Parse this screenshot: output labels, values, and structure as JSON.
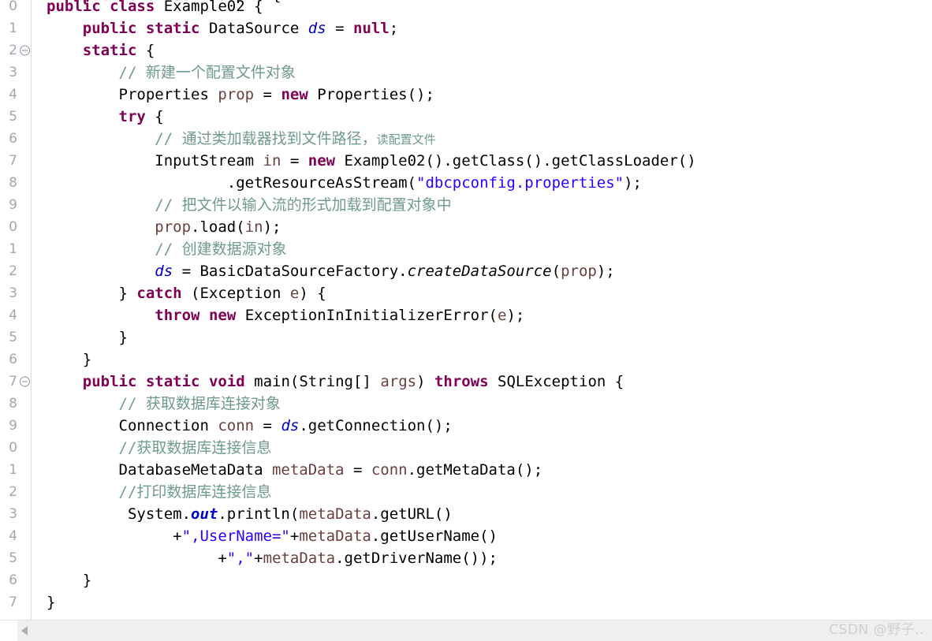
{
  "editor": {
    "language": "java",
    "class_name": "Example02",
    "colors": {
      "keyword": "#7f0055",
      "comment": "#6f9b8a",
      "string": "#2a00ff",
      "field": "#0000c0",
      "local_variable": "#6a3e3e",
      "plain": "#000000",
      "gutter_text": "#a0a8b4",
      "background": "#ffffff",
      "scrollbar": "#efefef"
    },
    "clipped_top_line": {
      "segments": [
        {
          "t": "    ",
          "c": "pl"
        },
        {
          "t": "public",
          "c": "kw"
        },
        {
          "t": " ",
          "c": "pl"
        },
        {
          "t": "class",
          "c": "kw"
        },
        {
          "t": " Example { ",
          "c": "pl"
        }
      ]
    },
    "lines": [
      {
        "number": "0",
        "fold": false,
        "segments": [
          {
            "t": "public",
            "c": "kw"
          },
          {
            "t": " ",
            "c": "pl"
          },
          {
            "t": "class",
            "c": "kw"
          },
          {
            "t": " Example02 {",
            "c": "pl"
          }
        ]
      },
      {
        "number": "1",
        "fold": false,
        "segments": [
          {
            "t": "    ",
            "c": "pl"
          },
          {
            "t": "public",
            "c": "kw"
          },
          {
            "t": " ",
            "c": "pl"
          },
          {
            "t": "static",
            "c": "kw"
          },
          {
            "t": " DataSource ",
            "c": "pl"
          },
          {
            "t": "ds",
            "c": "fld"
          },
          {
            "t": " = ",
            "c": "pl"
          },
          {
            "t": "null",
            "c": "kw"
          },
          {
            "t": ";",
            "c": "pl"
          }
        ]
      },
      {
        "number": "2",
        "fold": true,
        "segments": [
          {
            "t": "    ",
            "c": "pl"
          },
          {
            "t": "static",
            "c": "kw"
          },
          {
            "t": " {",
            "c": "pl"
          }
        ]
      },
      {
        "number": "3",
        "fold": false,
        "segments": [
          {
            "t": "        ",
            "c": "pl"
          },
          {
            "t": "// 新建一个配置文件对象",
            "c": "cmt"
          }
        ]
      },
      {
        "number": "4",
        "fold": false,
        "segments": [
          {
            "t": "        Properties ",
            "c": "pl"
          },
          {
            "t": "prop",
            "c": "lv"
          },
          {
            "t": " = ",
            "c": "pl"
          },
          {
            "t": "new",
            "c": "kw"
          },
          {
            "t": " Properties();",
            "c": "pl"
          }
        ]
      },
      {
        "number": "5",
        "fold": false,
        "segments": [
          {
            "t": "        ",
            "c": "pl"
          },
          {
            "t": "try",
            "c": "kw"
          },
          {
            "t": " {",
            "c": "pl"
          }
        ]
      },
      {
        "number": "6",
        "fold": false,
        "segments": [
          {
            "t": "            ",
            "c": "pl"
          },
          {
            "t": "// 通过类加载器找到文件路径，",
            "c": "cmt"
          },
          {
            "t": "读配置文件",
            "c": "cmt-sm"
          }
        ]
      },
      {
        "number": "7",
        "fold": false,
        "segments": [
          {
            "t": "            InputStream ",
            "c": "pl"
          },
          {
            "t": "in",
            "c": "lv"
          },
          {
            "t": " = ",
            "c": "pl"
          },
          {
            "t": "new",
            "c": "kw"
          },
          {
            "t": " Example02().getClass().getClassLoader()",
            "c": "pl"
          }
        ]
      },
      {
        "number": "8",
        "fold": false,
        "segments": [
          {
            "t": "                    .getResourceAsStream(",
            "c": "pl"
          },
          {
            "t": "\"dbcpconfig.properties\"",
            "c": "str"
          },
          {
            "t": ");",
            "c": "pl"
          }
        ]
      },
      {
        "number": "9",
        "fold": false,
        "segments": [
          {
            "t": "            ",
            "c": "pl"
          },
          {
            "t": "// 把文件以输入流的形式加载到配置对象中",
            "c": "cmt"
          }
        ]
      },
      {
        "number": "0",
        "fold": false,
        "segments": [
          {
            "t": "            ",
            "c": "pl"
          },
          {
            "t": "prop",
            "c": "lv"
          },
          {
            "t": ".load(",
            "c": "pl"
          },
          {
            "t": "in",
            "c": "lv"
          },
          {
            "t": ");",
            "c": "pl"
          }
        ]
      },
      {
        "number": "1",
        "fold": false,
        "segments": [
          {
            "t": "            ",
            "c": "pl"
          },
          {
            "t": "// 创建数据源对象",
            "c": "cmt"
          }
        ]
      },
      {
        "number": "2",
        "fold": false,
        "segments": [
          {
            "t": "            ",
            "c": "pl"
          },
          {
            "t": "ds",
            "c": "fld"
          },
          {
            "t": " = BasicDataSourceFactory.",
            "c": "pl"
          },
          {
            "t": "createDataSource",
            "c": "stm"
          },
          {
            "t": "(",
            "c": "pl"
          },
          {
            "t": "prop",
            "c": "lv"
          },
          {
            "t": ");",
            "c": "pl"
          }
        ]
      },
      {
        "number": "3",
        "fold": false,
        "segments": [
          {
            "t": "        } ",
            "c": "pl"
          },
          {
            "t": "catch",
            "c": "kw"
          },
          {
            "t": " (Exception ",
            "c": "pl"
          },
          {
            "t": "e",
            "c": "lv"
          },
          {
            "t": ") {",
            "c": "pl"
          }
        ]
      },
      {
        "number": "4",
        "fold": false,
        "segments": [
          {
            "t": "            ",
            "c": "pl"
          },
          {
            "t": "throw",
            "c": "kw"
          },
          {
            "t": " ",
            "c": "pl"
          },
          {
            "t": "new",
            "c": "kw"
          },
          {
            "t": " ExceptionInInitializerError(",
            "c": "pl"
          },
          {
            "t": "e",
            "c": "lv"
          },
          {
            "t": ");",
            "c": "pl"
          }
        ]
      },
      {
        "number": "5",
        "fold": false,
        "segments": [
          {
            "t": "        }",
            "c": "pl"
          }
        ]
      },
      {
        "number": "6",
        "fold": false,
        "segments": [
          {
            "t": "    }",
            "c": "pl"
          }
        ]
      },
      {
        "number": "7",
        "fold": true,
        "segments": [
          {
            "t": "    ",
            "c": "pl"
          },
          {
            "t": "public",
            "c": "kw"
          },
          {
            "t": " ",
            "c": "pl"
          },
          {
            "t": "static",
            "c": "kw"
          },
          {
            "t": " ",
            "c": "pl"
          },
          {
            "t": "void",
            "c": "kw"
          },
          {
            "t": " main(String[] ",
            "c": "pl"
          },
          {
            "t": "args",
            "c": "lv"
          },
          {
            "t": ") ",
            "c": "pl"
          },
          {
            "t": "throws",
            "c": "kw"
          },
          {
            "t": " SQLException {",
            "c": "pl"
          }
        ]
      },
      {
        "number": "8",
        "fold": false,
        "segments": [
          {
            "t": "        ",
            "c": "pl"
          },
          {
            "t": "// 获取数据库连接对象",
            "c": "cmt"
          }
        ]
      },
      {
        "number": "9",
        "fold": false,
        "segments": [
          {
            "t": "        Connection ",
            "c": "pl"
          },
          {
            "t": "conn",
            "c": "lv"
          },
          {
            "t": " = ",
            "c": "pl"
          },
          {
            "t": "ds",
            "c": "fld"
          },
          {
            "t": ".getConnection();",
            "c": "pl"
          }
        ]
      },
      {
        "number": "0",
        "fold": false,
        "segments": [
          {
            "t": "        ",
            "c": "pl"
          },
          {
            "t": "//获取数据库连接信息",
            "c": "cmt"
          }
        ]
      },
      {
        "number": "1",
        "fold": false,
        "segments": [
          {
            "t": "        DatabaseMetaData ",
            "c": "pl"
          },
          {
            "t": "metaData",
            "c": "lv"
          },
          {
            "t": " = ",
            "c": "pl"
          },
          {
            "t": "conn",
            "c": "lv"
          },
          {
            "t": ".getMetaData();",
            "c": "pl"
          }
        ]
      },
      {
        "number": "2",
        "fold": false,
        "segments": [
          {
            "t": "        ",
            "c": "pl"
          },
          {
            "t": "//打印数据库连接信息",
            "c": "cmt"
          }
        ]
      },
      {
        "number": "3",
        "fold": false,
        "segments": [
          {
            "t": "         System.",
            "c": "pl"
          },
          {
            "t": "out",
            "c": "fld-b"
          },
          {
            "t": ".println(",
            "c": "pl"
          },
          {
            "t": "metaData",
            "c": "lv"
          },
          {
            "t": ".getURL()",
            "c": "pl"
          }
        ]
      },
      {
        "number": "4",
        "fold": false,
        "segments": [
          {
            "t": "              +",
            "c": "pl"
          },
          {
            "t": "\",UserName=\"",
            "c": "str"
          },
          {
            "t": "+",
            "c": "pl"
          },
          {
            "t": "metaData",
            "c": "lv"
          },
          {
            "t": ".getUserName()",
            "c": "pl"
          }
        ]
      },
      {
        "number": "5",
        "fold": false,
        "segments": [
          {
            "t": "                   +",
            "c": "pl"
          },
          {
            "t": "\",\"",
            "c": "str"
          },
          {
            "t": "+",
            "c": "pl"
          },
          {
            "t": "metaData",
            "c": "lv"
          },
          {
            "t": ".getDriverName());",
            "c": "pl"
          }
        ]
      },
      {
        "number": "6",
        "fold": false,
        "segments": [
          {
            "t": "    }",
            "c": "pl"
          }
        ]
      },
      {
        "number": "7",
        "fold": false,
        "segments": [
          {
            "t": "}",
            "c": "pl"
          }
        ]
      }
    ]
  },
  "scrollbar": {
    "left_arrow_icon": "triangle-left-icon",
    "orientation": "horizontal"
  },
  "watermark": {
    "text": "CSDN @野子.."
  }
}
